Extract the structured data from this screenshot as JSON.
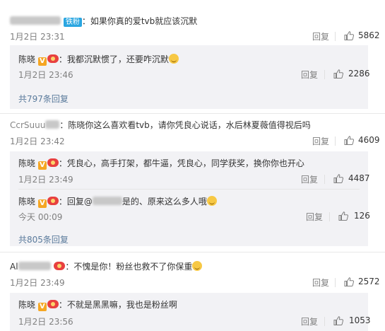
{
  "comments": [
    {
      "id": "c1",
      "fan_badge": "铁粉",
      "text": "：如果你真的爱tvb就应该沉默",
      "time": "1月2日 23:31",
      "reply_label": "回复",
      "likes": "5862",
      "replies": [
        {
          "user": "陈晓",
          "text": "：我都沉默惯了，还要咋沉默",
          "time": "1月2日 23:46",
          "reply_label": "回复",
          "likes": "2286"
        }
      ],
      "more_replies": "共797条回复"
    },
    {
      "id": "c2",
      "user_partial": "CcrSuuu",
      "text": "：陈晓你这么喜欢看tvb，请你凭良心说话，水后林夏薇值得视后吗",
      "time": "1月2日 23:42",
      "reply_label": "回复",
      "likes": "4609",
      "replies": [
        {
          "user": "陈晓",
          "text": "：凭良心，高手打架，都牛逼，凭良心，同学获奖，换你你也开心",
          "time": "1月2日 23:49",
          "reply_label": "回复",
          "likes": "4487"
        },
        {
          "user": "陈晓",
          "text_prefix": "：回复@",
          "text_suffix": "是的、原来这么多人哦",
          "time": "今天 00:09",
          "reply_label": "回复",
          "likes": "126"
        }
      ],
      "more_replies": "共805条回复"
    },
    {
      "id": "c3",
      "user_partial": "Al",
      "text": "：不愧是你！粉丝也救不了你保重",
      "time": "1月2日 23:49",
      "reply_label": "回复",
      "likes": "2572",
      "replies": [
        {
          "user": "陈晓",
          "text": "：不就是黑黑嘛，我也是粉丝啊",
          "time": "1月2日 23:56",
          "reply_label": "回复",
          "likes": "1053"
        }
      ]
    }
  ],
  "colors": {
    "username": "#333333",
    "more_link": "#5b7b9c",
    "sub_bg": "#f2f2f5",
    "meta": "#808080"
  },
  "icons": {
    "like": "thumbs-up-icon",
    "verified": "verified-v-icon",
    "vip": "vip-crown-icon",
    "emoji": "smile-emoji-icon"
  }
}
